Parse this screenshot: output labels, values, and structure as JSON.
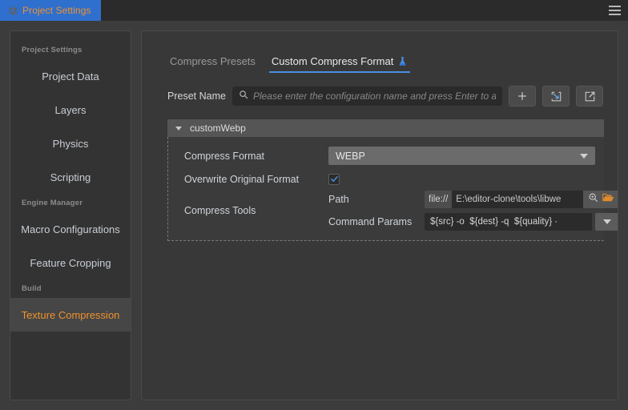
{
  "window": {
    "tab_title": "Project Settings",
    "tab_icon": "gear-icon",
    "menu_icon": "hamburger-menu-icon",
    "accent_blue": "#2f6fce",
    "accent_orange": "#f0922b"
  },
  "sidebar": {
    "groups": [
      {
        "title": "Project Settings",
        "items": [
          {
            "label": "Project Data",
            "active": false
          },
          {
            "label": "Layers",
            "active": false
          },
          {
            "label": "Physics",
            "active": false
          },
          {
            "label": "Scripting",
            "active": false
          }
        ]
      },
      {
        "title": "Engine Manager",
        "items": [
          {
            "label": "Macro Configurations",
            "active": false
          },
          {
            "label": "Feature Cropping",
            "active": false
          }
        ]
      },
      {
        "title": "Build",
        "items": [
          {
            "label": "Texture Compression",
            "active": true
          }
        ]
      }
    ]
  },
  "main": {
    "tabs": [
      {
        "label": "Compress Presets",
        "active": false,
        "icon": null
      },
      {
        "label": "Custom Compress Format",
        "active": true,
        "icon": "flask-icon"
      }
    ],
    "preset": {
      "label": "Preset Name",
      "search_icon": "search-icon",
      "value": "",
      "placeholder": "Please enter the configuration name and press Enter to a",
      "buttons": [
        {
          "name": "add-preset-button",
          "icon": "plus-icon"
        },
        {
          "name": "import-preset-button",
          "icon": "import-icon"
        },
        {
          "name": "export-preset-button",
          "icon": "export-icon"
        }
      ]
    },
    "group": {
      "title": "customWebp",
      "expanded": true,
      "caret_icon": "chevron-down-icon",
      "fields": {
        "compress_format": {
          "label": "Compress Format",
          "value": "WEBP",
          "caret_icon": "chevron-down-icon"
        },
        "overwrite_original": {
          "label": "Overwrite Original Format",
          "checked": true,
          "check_icon": "check-icon"
        },
        "compress_tools": {
          "label": "Compress Tools",
          "path": {
            "label": "Path",
            "protocol": "file://",
            "value": "E:\\editor-clone\\tools\\libwe",
            "inspect_icon": "magnifier-icon",
            "browse_icon": "folder-open-icon"
          },
          "command_params": {
            "label": "Command Params",
            "value": "${src} -o  ${dest} -q  ${quality} ·",
            "caret_icon": "chevron-down-icon"
          }
        }
      }
    }
  }
}
